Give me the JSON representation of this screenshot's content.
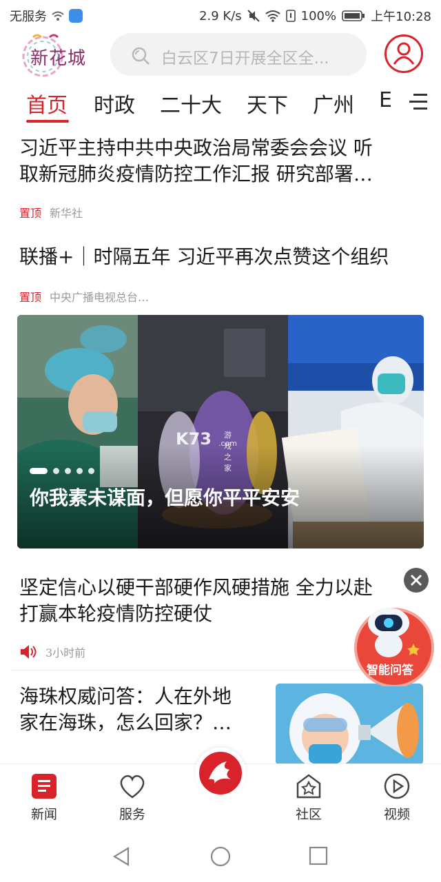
{
  "status_bar": {
    "carrier": "无服务",
    "speed": "2.9 K/s",
    "battery": "100%",
    "time": "上午10:28"
  },
  "header": {
    "logo_text": "新花城",
    "search_placeholder": "白云区7日开展全区全...",
    "brand_color": "#d8232a"
  },
  "tabs": [
    {
      "label": "首页",
      "active": true
    },
    {
      "label": "时政"
    },
    {
      "label": "二十大"
    },
    {
      "label": "天下"
    },
    {
      "label": "广州"
    },
    {
      "label": "E"
    }
  ],
  "news": [
    {
      "title_line1": "习近平主持中共中央政治局常委会会议  听",
      "title_line2": "取新冠肺炎疫情防控工作汇报  研究部署…",
      "badge": "置顶",
      "source": "新华社"
    },
    {
      "title_line1": "联播+｜时隔五年  习近平再次点赞这个组织",
      "badge": "置顶",
      "source": "中央广播电视总台…"
    }
  ],
  "banner": {
    "caption": "你我素未谋面，但愿你平平安安",
    "slide_count": 5,
    "active_slide": 1,
    "watermark_main": "K73",
    "watermark_sub": "游戏之家",
    "watermark_com": ".com"
  },
  "feed": [
    {
      "title_line1": "坚定信心以硬干部硬作风硬措施  全力以赴",
      "title_line2": "打赢本轮疫情防控硬仗",
      "time": "3小时前",
      "icon": "speaker-icon"
    },
    {
      "title_line1": "海珠权威问答：人在外地",
      "title_line2": "家在海珠，怎么回家？…"
    }
  ],
  "floating": {
    "label": "智能问答"
  },
  "bottom_nav": [
    {
      "label": "新闻",
      "icon": "news-icon",
      "active": true
    },
    {
      "label": "服务",
      "icon": "heart-icon"
    },
    {
      "label": "社区",
      "icon": "community-icon"
    },
    {
      "label": "视频",
      "icon": "play-icon"
    }
  ]
}
